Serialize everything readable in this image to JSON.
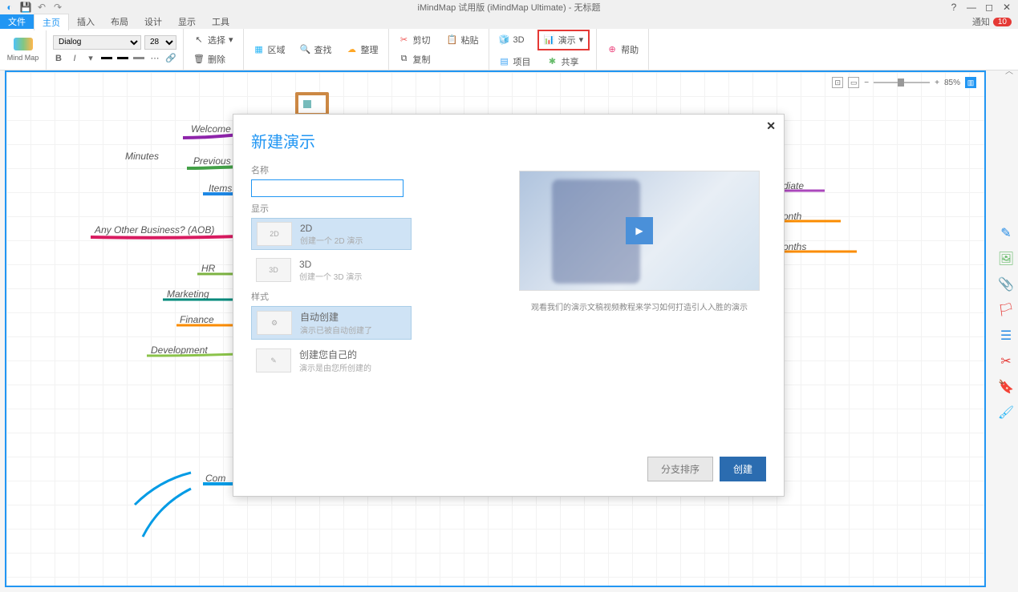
{
  "titlebar": {
    "title": "iMindMap 试用版 (iMindMap Ultimate) - 无标题"
  },
  "menubar": {
    "file": "文件",
    "tabs": [
      "主页",
      "插入",
      "布局",
      "设计",
      "显示",
      "工具"
    ],
    "notify_label": "通知",
    "notify_count": "10"
  },
  "ribbon": {
    "mind_label": "Mind Map",
    "font_name": "Dialog",
    "font_size": "28",
    "select": "选择",
    "delete": "删除",
    "region": "区域",
    "find": "查找",
    "tidy": "整理",
    "cut": "剪切",
    "paste": "粘贴",
    "copy": "复制",
    "threeD": "3D",
    "project": "项目",
    "present": "演示",
    "share": "共享",
    "help": "帮助"
  },
  "canvas": {
    "branches": {
      "welcome": "Welcome",
      "minutes": "Minutes",
      "previous": "Previous",
      "items": "Items",
      "aob": "Any Other Business? (AOB)",
      "hr": "HR",
      "marketing": "Marketing",
      "finance": "Finance",
      "development": "Development",
      "com": "Com",
      "diate": "diate",
      "onth": "onth",
      "onths": "onths"
    },
    "zoom_pct": "85%"
  },
  "modal": {
    "title": "新建演示",
    "name_label": "名称",
    "display_label": "显示",
    "style_label": "样式",
    "opt_2d_t": "2D",
    "opt_2d_d": "创建一个 2D 演示",
    "opt_3d_t": "3D",
    "opt_3d_d": "创建一个 3D 演示",
    "opt_auto_t": "自动创建",
    "opt_auto_d": "演示已被自动创建了",
    "opt_own_t": "创建您自己的",
    "opt_own_d": "演示是由您所创建的",
    "video_caption": "观看我们的演示文稿视频教程来学习如何打造引人入胜的演示",
    "btn_sort": "分支排序",
    "btn_create": "创建"
  },
  "thumbs": {
    "t2d": "2D",
    "t3d": "3D"
  }
}
